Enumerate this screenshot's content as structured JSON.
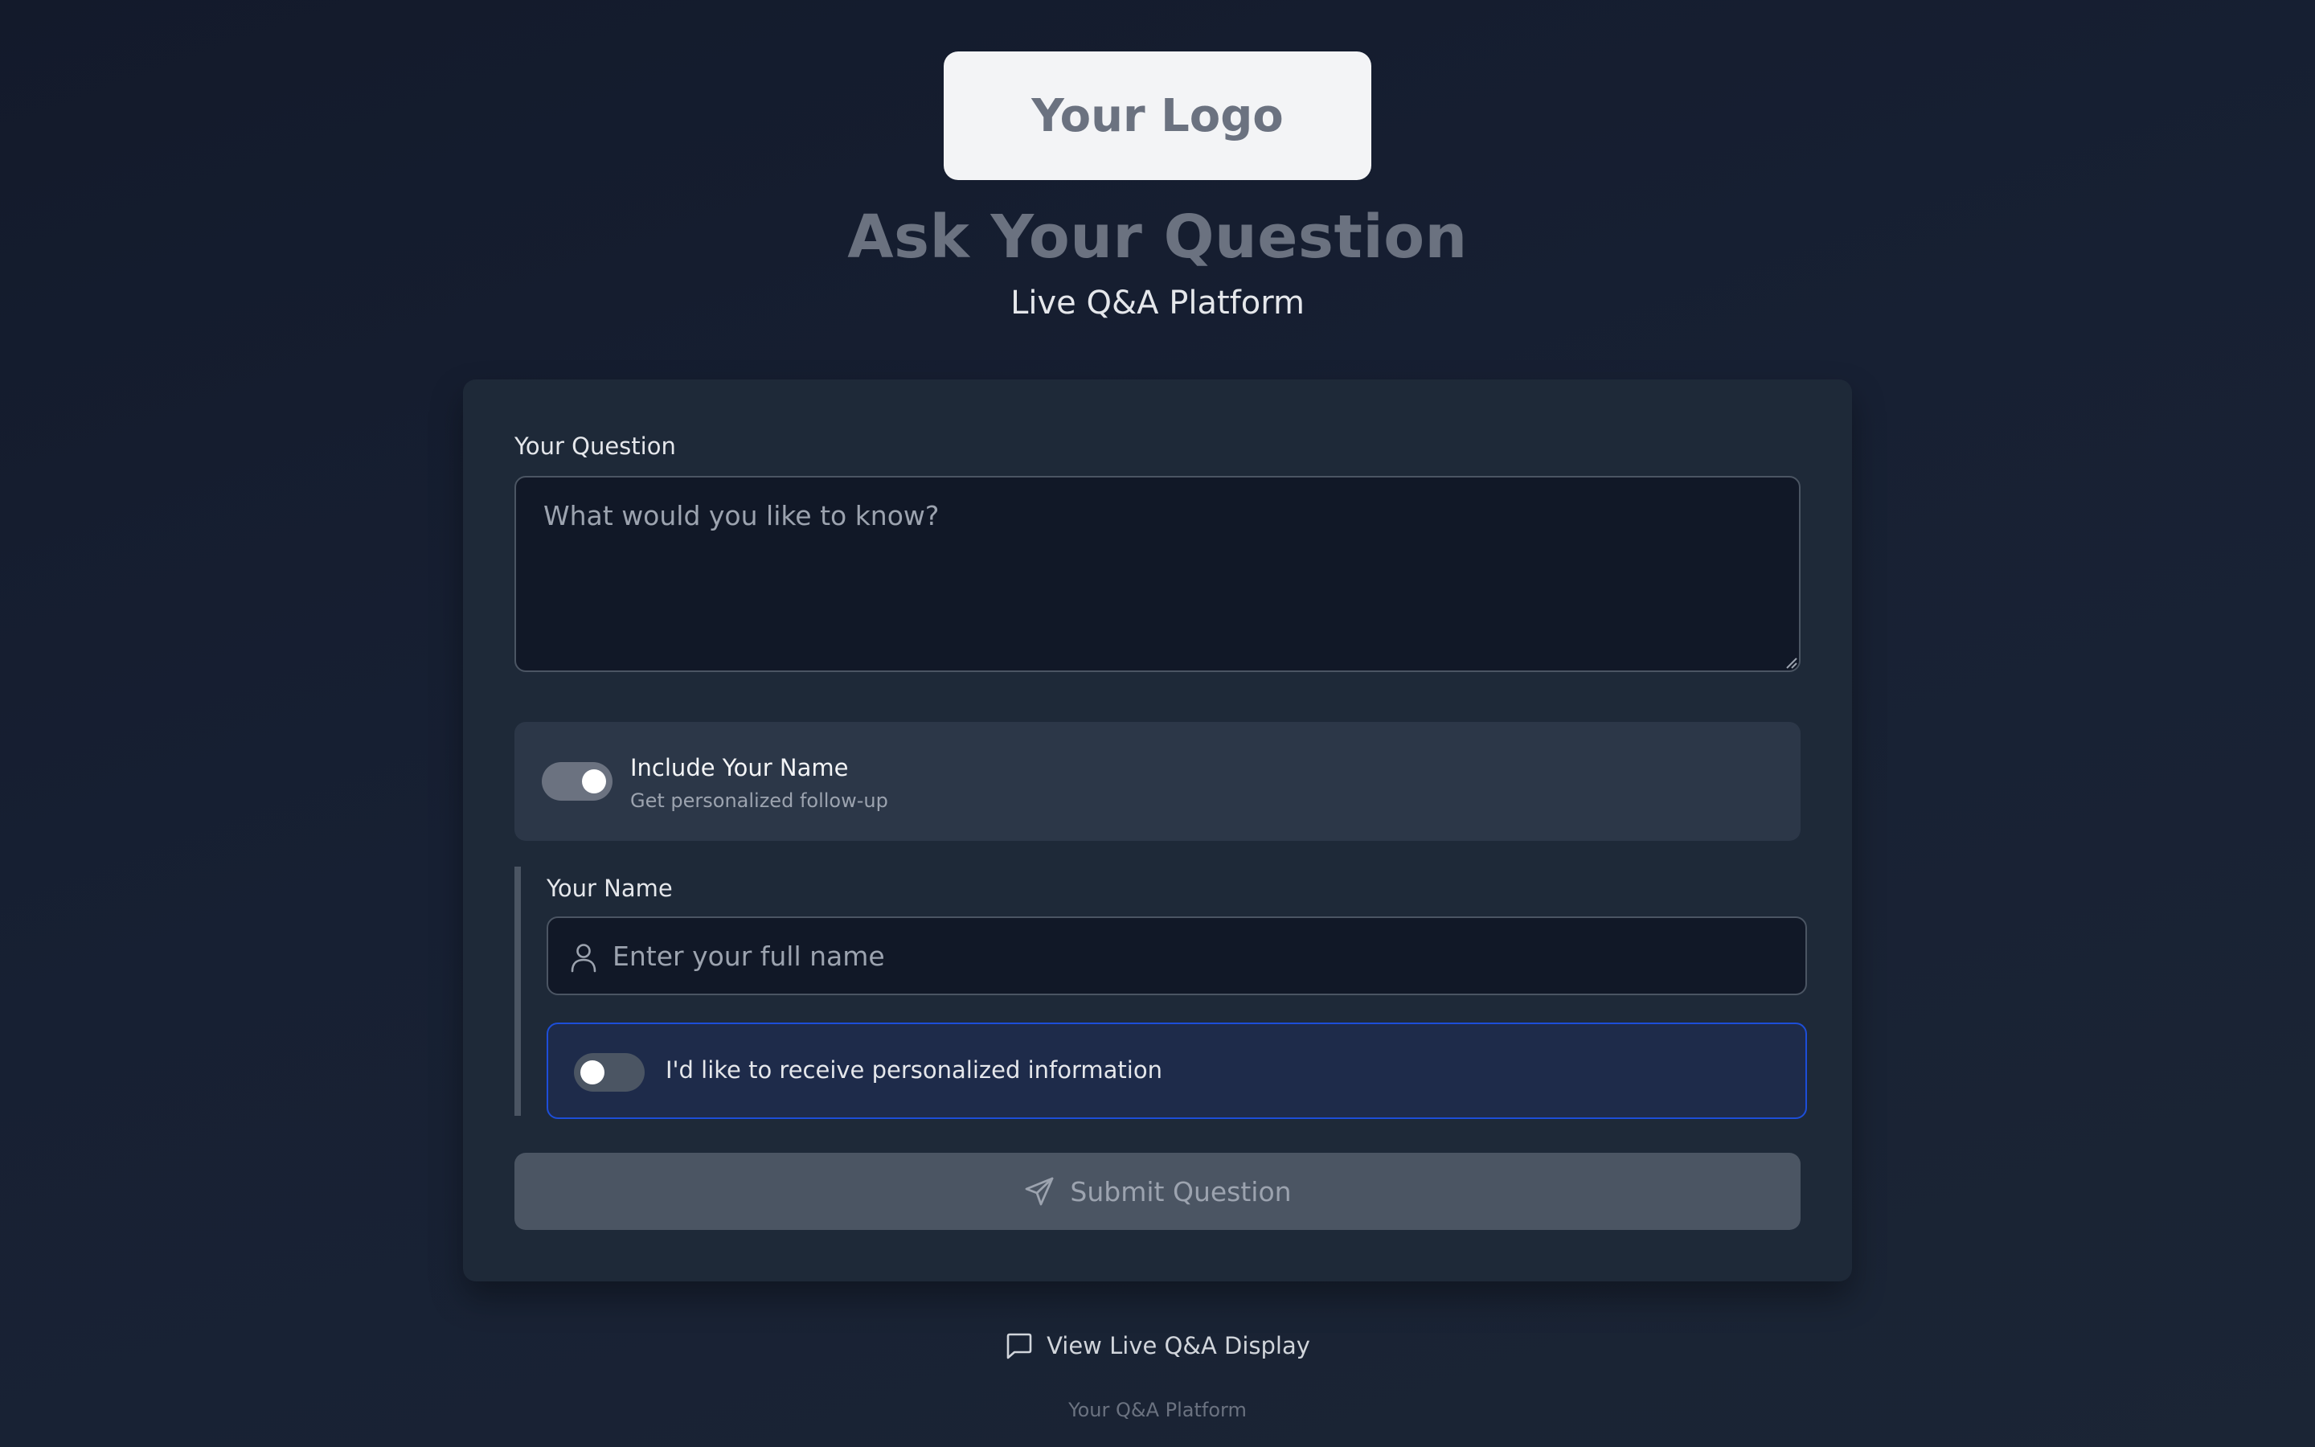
{
  "header": {
    "logo_text": "Your Logo",
    "title": "Ask Your Question",
    "subtitle": "Live Q&A Platform"
  },
  "form": {
    "question_label": "Your Question",
    "question_placeholder": "What would you like to know?",
    "question_value": "",
    "include_name": {
      "label": "Include Your Name",
      "description": "Get personalized follow-up",
      "enabled": true
    },
    "name_label": "Your Name",
    "name_placeholder": "Enter your full name",
    "name_value": "",
    "opt_in": {
      "label": "I'd like to receive personalized information",
      "enabled": false
    },
    "submit_label": "Submit Question",
    "submit_icon": "send-icon"
  },
  "footer": {
    "link_label": "View Live Q&A Display",
    "link_icon": "chat-icon",
    "brand": "Your Q&A Platform"
  },
  "colors": {
    "background": "#151c2c",
    "card": "#1e2938",
    "accent_border": "#1d4ed8",
    "button_disabled": "#4b5563"
  }
}
